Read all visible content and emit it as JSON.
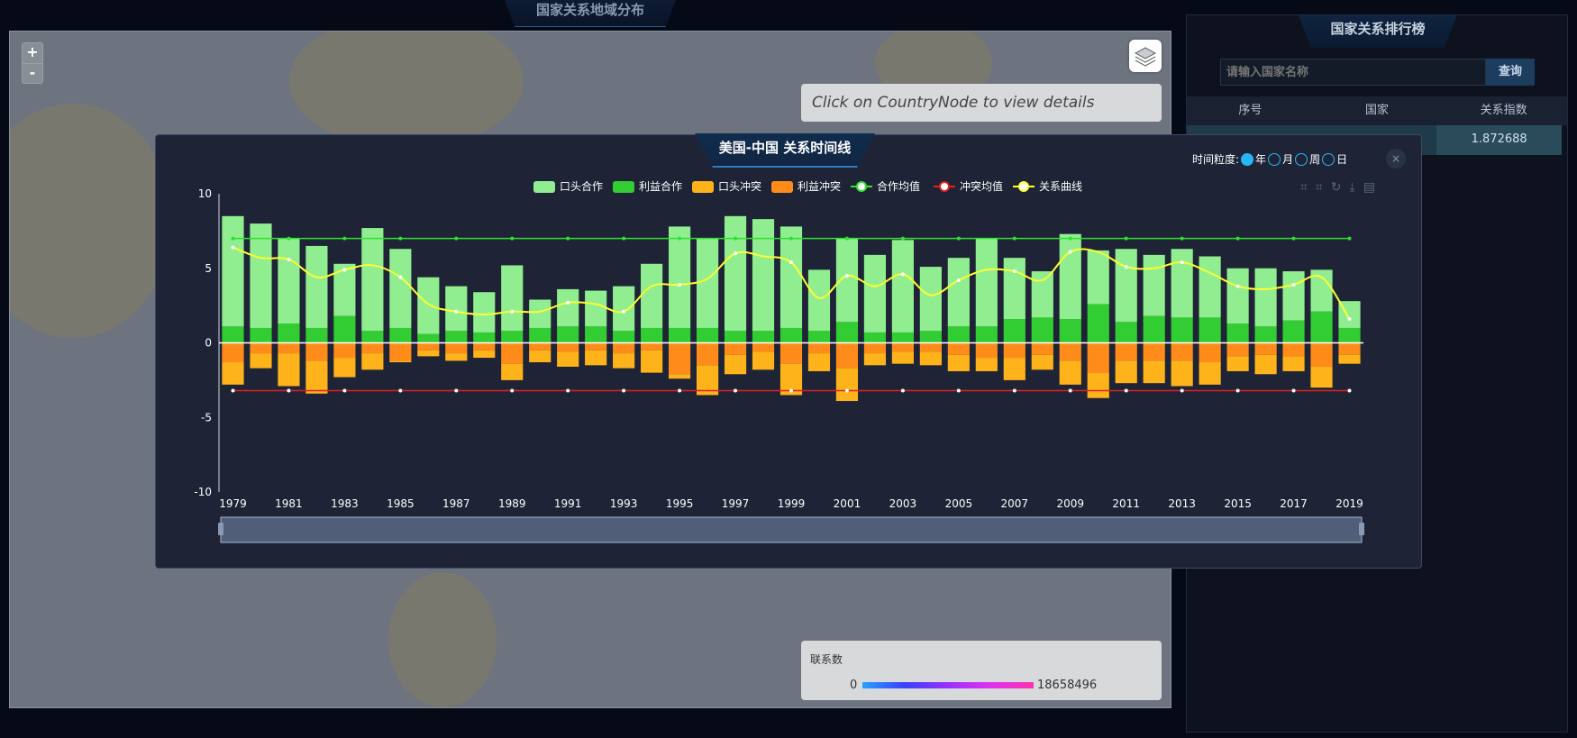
{
  "map": {
    "title": "国家关系地域分布",
    "zoom_in": "+",
    "zoom_out": "-",
    "hint": "Click on CountryNode to view details",
    "legend": {
      "title": "联系数",
      "min": "0",
      "max": "18658496"
    }
  },
  "ranking": {
    "title": "国家关系排行榜",
    "search_placeholder": "请输入国家名称",
    "search_button": "查询",
    "columns": [
      "序号",
      "国家",
      "关系指数"
    ],
    "rows": [
      {
        "rank": "",
        "country": "",
        "index": "1.872688"
      }
    ]
  },
  "modal": {
    "title": "美国-中国 关系时间线",
    "granularity_label": "时间粒度:",
    "granularity_options": [
      "年",
      "月",
      "周",
      "日"
    ],
    "granularity_selected": "年",
    "close": "×"
  },
  "chart_data": {
    "type": "bar",
    "x": [
      1979,
      1980,
      1981,
      1982,
      1983,
      1984,
      1985,
      1986,
      1987,
      1988,
      1989,
      1990,
      1991,
      1992,
      1993,
      1994,
      1995,
      1996,
      1997,
      1998,
      1999,
      2000,
      2001,
      2002,
      2003,
      2004,
      2005,
      2006,
      2007,
      2008,
      2009,
      2010,
      2011,
      2012,
      2013,
      2014,
      2015,
      2016,
      2017,
      2018,
      2019
    ],
    "x_tick_labels": [
      "1979",
      "1981",
      "1983",
      "1985",
      "1987",
      "1989",
      "1991",
      "1993",
      "1995",
      "1997",
      "1999",
      "2001",
      "2003",
      "2005",
      "2007",
      "2009",
      "2011",
      "2013",
      "2015",
      "2017",
      "2019"
    ],
    "ylim": [
      -10,
      10
    ],
    "y_ticks": [
      10,
      5,
      0,
      -5,
      -10
    ],
    "legend": [
      "口头合作",
      "利益合作",
      "口头冲突",
      "利益冲突",
      "合作均值",
      "冲突均值",
      "关系曲线"
    ],
    "legend_position": "top",
    "colors": {
      "verbal_coop": "#90ee90",
      "material_coop": "#32cd32",
      "verbal_conflict": "#ffb31a",
      "material_conflict": "#ff8c1a",
      "coop_mean": "#32e032",
      "conflict_mean": "#e02020",
      "relation_curve": "#ffff33"
    },
    "series": [
      {
        "name": "利益合作",
        "stack": "coop",
        "values": [
          1.1,
          1.0,
          1.3,
          1.0,
          1.8,
          0.8,
          1.0,
          0.6,
          0.8,
          0.7,
          0.8,
          1.0,
          1.1,
          1.1,
          0.8,
          1.0,
          1.0,
          1.0,
          0.8,
          0.8,
          1.0,
          0.8,
          1.4,
          0.7,
          0.7,
          0.8,
          1.1,
          1.1,
          1.6,
          1.7,
          1.6,
          2.6,
          1.4,
          1.8,
          1.7,
          1.7,
          1.3,
          1.1,
          1.5,
          2.1,
          1.0
        ]
      },
      {
        "name": "口头合作",
        "stack": "coop",
        "values": [
          7.4,
          7.0,
          5.7,
          5.5,
          3.5,
          6.9,
          5.3,
          3.8,
          3.0,
          2.7,
          4.4,
          1.9,
          2.5,
          2.4,
          3.0,
          4.3,
          6.8,
          6.0,
          7.7,
          7.5,
          6.8,
          4.1,
          5.6,
          5.2,
          6.2,
          4.3,
          4.6,
          5.9,
          4.1,
          3.1,
          5.7,
          3.6,
          4.9,
          4.1,
          4.6,
          4.1,
          3.7,
          3.9,
          3.3,
          2.8,
          1.8
        ]
      },
      {
        "name": "利益冲突",
        "stack": "conflict",
        "values": [
          -1.3,
          -0.7,
          -0.7,
          -1.2,
          -1.0,
          -0.7,
          -1.2,
          -0.5,
          -0.7,
          -0.5,
          -1.4,
          -0.5,
          -0.6,
          -0.5,
          -0.7,
          -0.5,
          -2.1,
          -1.5,
          -0.8,
          -0.6,
          -1.4,
          -0.7,
          -1.7,
          -0.7,
          -0.6,
          -0.6,
          -0.8,
          -1.0,
          -1.0,
          -0.8,
          -1.2,
          -2.0,
          -1.2,
          -1.2,
          -1.2,
          -1.3,
          -0.9,
          -0.8,
          -0.9,
          -1.6,
          -0.8
        ]
      },
      {
        "name": "口头冲突",
        "stack": "conflict",
        "values": [
          -1.5,
          -1.0,
          -2.2,
          -2.2,
          -1.3,
          -1.1,
          -0.1,
          -0.4,
          -0.5,
          -0.5,
          -1.1,
          -0.8,
          -1.0,
          -1.0,
          -1.0,
          -1.5,
          -0.3,
          -2.0,
          -1.3,
          -1.2,
          -2.1,
          -1.2,
          -2.2,
          -0.8,
          -0.8,
          -0.9,
          -1.1,
          -0.9,
          -1.5,
          -1.0,
          -1.6,
          -1.7,
          -1.5,
          -1.5,
          -1.7,
          -1.5,
          -1.0,
          -1.3,
          -1.0,
          -1.4,
          -0.6
        ]
      },
      {
        "name": "关系曲线",
        "type": "line",
        "values": [
          6.4,
          5.7,
          5.6,
          4.4,
          4.9,
          5.2,
          4.4,
          2.6,
          2.1,
          1.9,
          2.1,
          2.1,
          2.7,
          2.6,
          2.1,
          3.8,
          3.9,
          4.3,
          6.0,
          5.8,
          5.4,
          3.0,
          4.5,
          3.8,
          4.6,
          3.2,
          4.2,
          4.9,
          4.8,
          4.2,
          6.1,
          6.1,
          5.1,
          5.0,
          5.4,
          4.7,
          3.8,
          3.6,
          3.9,
          4.4,
          1.6
        ]
      },
      {
        "name": "合作均值",
        "type": "line",
        "value": 7.0
      },
      {
        "name": "冲突均值",
        "type": "line",
        "value": -3.2
      }
    ]
  }
}
